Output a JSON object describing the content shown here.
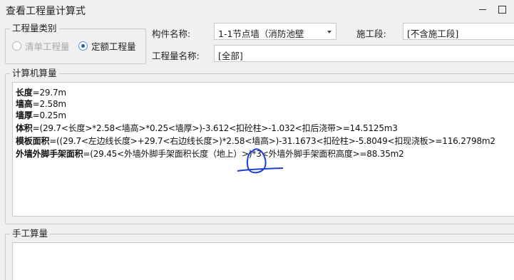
{
  "window": {
    "title": "查看工程量计算式"
  },
  "quantity_type": {
    "legend": "工程量类别",
    "options": [
      {
        "label": "清单工程量",
        "checked": false,
        "disabled": true
      },
      {
        "label": "定额工程量",
        "checked": true,
        "disabled": false
      }
    ]
  },
  "component": {
    "label": "构件名称:",
    "value": "1-1节点墙（消防池壁"
  },
  "stage": {
    "label": "施工段:",
    "value": "[不含施工段]"
  },
  "quantity_name": {
    "label": "工程量名称:",
    "value": "[全部]"
  },
  "computer_calc": {
    "legend": "计算机算量",
    "lines": [
      {
        "name": "长度",
        "expr": "=29.7m"
      },
      {
        "name": "墙高",
        "expr": "=2.58m"
      },
      {
        "name": "墙厚",
        "expr": "=0.25m"
      },
      {
        "name": "体积",
        "expr": "=(29.7<长度>*2.58<墙高>*0.25<墙厚>)-3.612<扣砼柱>-1.032<扣后浇带>=14.5125m3"
      },
      {
        "name": "模板面积",
        "expr": "=((29.7<左边线长度>+29.7<右边线长度>)*2.58<墙高>)-31.1673<扣砼柱>-5.8049<扣现浇板>=116.2798m2"
      },
      {
        "name": "外墙外脚手架面积",
        "expr": "=(29.45<外墙外脚手架面积长度（地上）>)*3<外墙外脚手架面积高度>=88.35m2"
      }
    ]
  },
  "manual_calc": {
    "legend": "手工算量"
  },
  "colors": {
    "annotation": "#1a3fd0",
    "radio_selected": "#1f5fa6"
  }
}
